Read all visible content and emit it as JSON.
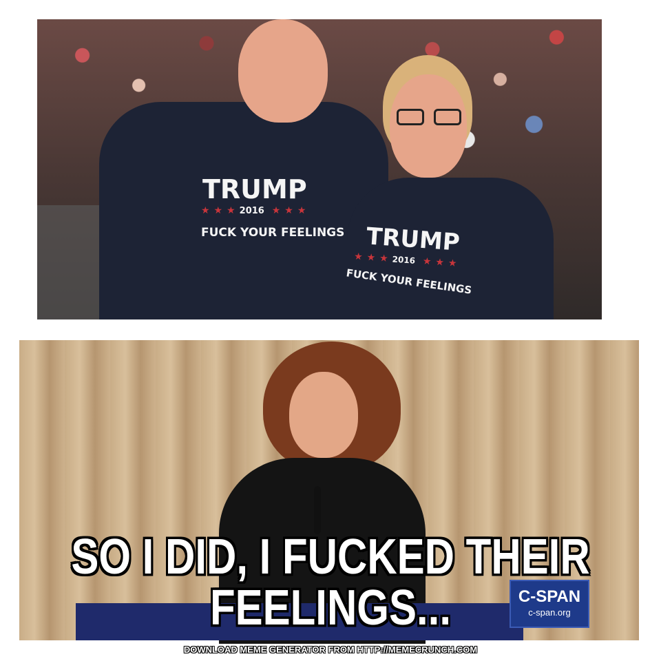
{
  "top_image": {
    "shirts": [
      {
        "title": "TRUMP",
        "year": "2016",
        "slogan": "FUCK YOUR FEELINGS"
      },
      {
        "title": "TRUMP",
        "year": "2016",
        "slogan": "FUCK YOUR FEELINGS"
      }
    ]
  },
  "bottom_image": {
    "logo": {
      "main": "C-SPAN",
      "sub": "c-span.org"
    }
  },
  "caption": {
    "line1": "SO I DID, I FUCKED THEIR",
    "line2": "FEELINGS..."
  },
  "watermark": "DOWNLOAD MEME GENERATOR FROM HTTP://MEMECRUNCH.COM"
}
